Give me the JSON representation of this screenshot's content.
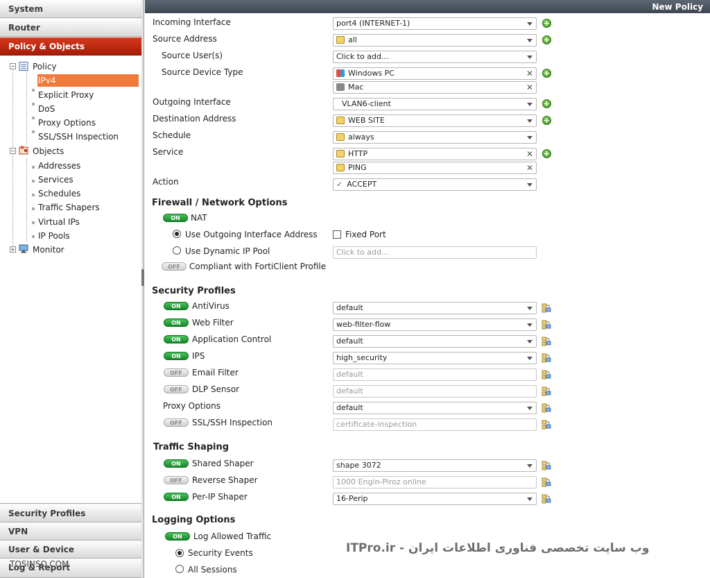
{
  "sidebar": {
    "top_sections": [
      "System",
      "Router",
      "Policy & Objects"
    ],
    "bottom_sections": [
      "Security Profiles",
      "VPN",
      "User & Device",
      "Log & Report"
    ],
    "tree": {
      "policy": "Policy",
      "policy_items": [
        "IPv4",
        "Explicit Proxy",
        "DoS",
        "Proxy Options",
        "SSL/SSH Inspection"
      ],
      "objects": "Objects",
      "objects_items": [
        "Addresses",
        "Services",
        "Schedules",
        "Traffic Shapers",
        "Virtual IPs",
        "IP Pools"
      ],
      "monitor": "Monitor"
    }
  },
  "title": "New Policy",
  "form": {
    "incoming_label": "Incoming Interface",
    "incoming_value": "port4 (INTERNET-1)",
    "src_addr_label": "Source Address",
    "src_addr_value": "all",
    "src_user_label": "Source User(s)",
    "src_user_value": "Click to add...",
    "src_dev_label": "Source Device Type",
    "src_dev_values": [
      "Windows PC",
      "Mac"
    ],
    "outgoing_label": "Outgoing Interface",
    "outgoing_value": "VLAN6-client",
    "dst_addr_label": "Destination Address",
    "dst_addr_value": "WEB SITE",
    "schedule_label": "Schedule",
    "schedule_value": "always",
    "service_label": "Service",
    "service_values": [
      "HTTP",
      "PING"
    ],
    "action_label": "Action",
    "action_value": "ACCEPT"
  },
  "firewall": {
    "header": "Firewall / Network Options",
    "nat_label": "NAT",
    "nat_state": "ON",
    "use_outgoing": "Use Outgoing Interface Address",
    "fixed_port": "Fixed Port",
    "use_dynamic": "Use Dynamic IP Pool",
    "pool_placeholder": "Click to add...",
    "compliant": "Compliant with FortiClient Profile",
    "compliant_state": "OFF"
  },
  "security": {
    "header": "Security Profiles",
    "rows": [
      {
        "label": "AntiVirus",
        "state": "ON",
        "value": "default"
      },
      {
        "label": "Web Filter",
        "state": "ON",
        "value": "web-filter-flow"
      },
      {
        "label": "Application Control",
        "state": "ON",
        "value": "default"
      },
      {
        "label": "IPS",
        "state": "ON",
        "value": "high_security"
      },
      {
        "label": "Email Filter",
        "state": "OFF",
        "value": "default"
      },
      {
        "label": "DLP Sensor",
        "state": "OFF",
        "value": "default"
      },
      {
        "label": "Proxy Options",
        "state": "",
        "value": "default"
      },
      {
        "label": "SSL/SSH Inspection",
        "state": "OFF",
        "value": "certificate-inspection"
      }
    ]
  },
  "shaping": {
    "header": "Traffic Shaping",
    "rows": [
      {
        "label": "Shared Shaper",
        "state": "ON",
        "value": "shape 3072"
      },
      {
        "label": "Reverse Shaper",
        "state": "OFF",
        "value": "1000 Engin-Piroz online"
      },
      {
        "label": "Per-IP Shaper",
        "state": "ON",
        "value": "16-Perip"
      }
    ]
  },
  "logging": {
    "header": "Logging Options",
    "log_allowed": "Log Allowed Traffic",
    "log_state": "ON",
    "security_events": "Security Events",
    "all_sessions": "All Sessions"
  },
  "watermark": {
    "right": "ITPro.ir - وب سایت تخصصی فناوری اطلاعات ایران",
    "left": "TOSINSO.COM"
  }
}
